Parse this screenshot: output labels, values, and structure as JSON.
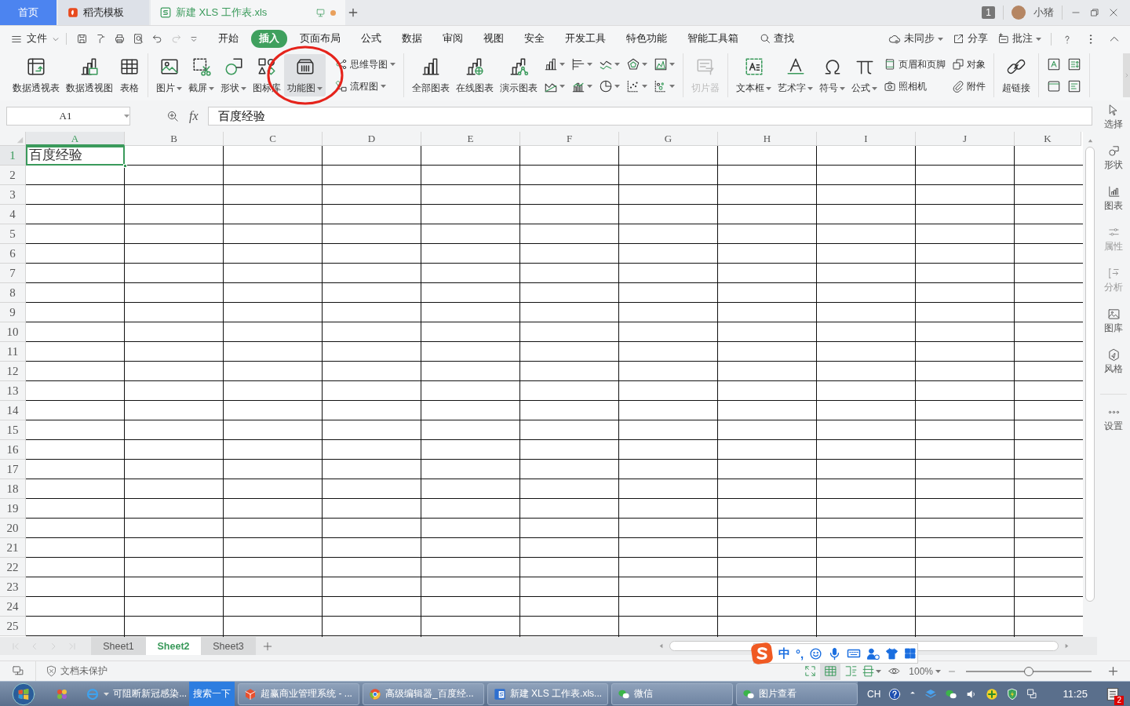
{
  "title_bar": {
    "tabs": [
      {
        "label": "首页",
        "kind": "home",
        "selected": false,
        "modified": false
      },
      {
        "label": "稻壳模板",
        "kind": "docer",
        "selected": false,
        "modified": false
      },
      {
        "label": "新建 XLS 工作表.xls",
        "kind": "sheet",
        "selected": true,
        "modified": true
      }
    ],
    "window_count": "1",
    "user": "小猪"
  },
  "menu_bar": {
    "file": "文件",
    "tabs": [
      {
        "label": "开始",
        "selected": false
      },
      {
        "label": "插入",
        "selected": true
      },
      {
        "label": "页面布局",
        "selected": false
      },
      {
        "label": "公式",
        "selected": false
      },
      {
        "label": "数据",
        "selected": false
      },
      {
        "label": "审阅",
        "selected": false
      },
      {
        "label": "视图",
        "selected": false
      },
      {
        "label": "安全",
        "selected": false
      },
      {
        "label": "开发工具",
        "selected": false
      },
      {
        "label": "特色功能",
        "selected": false
      },
      {
        "label": "智能工具箱",
        "selected": false
      }
    ],
    "search": "查找",
    "sync": "未同步",
    "share": "分享",
    "comment": "批注"
  },
  "ribbon": {
    "groups": [
      {
        "columns": [
          {
            "items": [
              {
                "label": "数据透视表",
                "kind": "large",
                "dropdown": false,
                "highlighted": false,
                "disabled": false
              }
            ]
          },
          {
            "items": [
              {
                "label": "数据透视图",
                "kind": "large",
                "dropdown": false,
                "highlighted": false,
                "disabled": false
              }
            ]
          },
          {
            "items": [
              {
                "label": "表格",
                "kind": "large",
                "dropdown": false,
                "highlighted": false,
                "disabled": false
              }
            ]
          }
        ]
      },
      {
        "columns": [
          {
            "items": [
              {
                "label": "图片",
                "kind": "large",
                "dropdown": true,
                "highlighted": false,
                "disabled": false
              }
            ]
          },
          {
            "items": [
              {
                "label": "截屏",
                "kind": "large",
                "dropdown": true,
                "highlighted": false,
                "disabled": false
              }
            ]
          },
          {
            "items": [
              {
                "label": "形状",
                "kind": "large",
                "dropdown": true,
                "highlighted": false,
                "disabled": false
              }
            ]
          },
          {
            "items": [
              {
                "label": "图标库",
                "kind": "large",
                "dropdown": false,
                "highlighted": false,
                "disabled": false
              }
            ]
          },
          {
            "items": [
              {
                "label": "功能图",
                "kind": "large",
                "dropdown": true,
                "highlighted": true,
                "disabled": false
              }
            ]
          },
          {
            "items": [
              {
                "label": "思维导图",
                "kind": "small",
                "dropdown": true,
                "highlighted": false,
                "disabled": false
              },
              {
                "label": "流程图",
                "kind": "small",
                "dropdown": true,
                "highlighted": false,
                "disabled": false
              }
            ]
          }
        ]
      },
      {
        "columns": [
          {
            "items": [
              {
                "label": "全部图表",
                "kind": "large",
                "dropdown": false,
                "highlighted": false,
                "disabled": false
              }
            ]
          },
          {
            "items": [
              {
                "label": "在线图表",
                "kind": "large",
                "dropdown": false,
                "highlighted": false,
                "disabled": false
              }
            ]
          },
          {
            "items": [
              {
                "label": "演示图表",
                "kind": "large",
                "dropdown": false,
                "highlighted": false,
                "disabled": false
              }
            ]
          },
          {
            "items": [
              {
                "kind": "icon",
                "dropdown": true,
                "highlighted": false,
                "disabled": false
              },
              {
                "kind": "icon",
                "dropdown": true,
                "highlighted": false,
                "disabled": false
              }
            ]
          },
          {
            "items": [
              {
                "kind": "icon",
                "dropdown": true,
                "highlighted": false,
                "disabled": false
              },
              {
                "kind": "icon",
                "dropdown": true,
                "highlighted": false,
                "disabled": false
              }
            ]
          },
          {
            "items": [
              {
                "kind": "icon",
                "dropdown": true,
                "highlighted": false,
                "disabled": false
              },
              {
                "kind": "icon",
                "dropdown": true,
                "highlighted": false,
                "disabled": false
              }
            ]
          },
          {
            "items": [
              {
                "kind": "icon",
                "dropdown": true,
                "highlighted": false,
                "disabled": false
              },
              {
                "kind": "icon",
                "dropdown": true,
                "highlighted": false,
                "disabled": false
              }
            ]
          },
          {
            "items": [
              {
                "kind": "icon",
                "dropdown": true,
                "highlighted": false,
                "disabled": false
              },
              {
                "kind": "icon",
                "dropdown": true,
                "highlighted": false,
                "disabled": false
              }
            ]
          }
        ]
      },
      {
        "columns": [
          {
            "items": [
              {
                "label": "切片器",
                "kind": "large",
                "dropdown": false,
                "highlighted": false,
                "disabled": true
              }
            ]
          }
        ]
      },
      {
        "columns": [
          {
            "items": [
              {
                "label": "文本框",
                "kind": "large",
                "dropdown": true,
                "highlighted": false,
                "disabled": false
              }
            ]
          },
          {
            "items": [
              {
                "label": "艺术字",
                "kind": "large",
                "dropdown": true,
                "highlighted": false,
                "disabled": false
              }
            ]
          },
          {
            "items": [
              {
                "label": "符号",
                "kind": "large",
                "dropdown": true,
                "highlighted": false,
                "disabled": false
              }
            ]
          },
          {
            "items": [
              {
                "label": "公式",
                "kind": "large",
                "dropdown": true,
                "highlighted": false,
                "disabled": false
              }
            ]
          },
          {
            "items": [
              {
                "label": "页眉和页脚",
                "kind": "small",
                "dropdown": false,
                "highlighted": false,
                "disabled": false
              },
              {
                "label": "照相机",
                "kind": "small",
                "dropdown": false,
                "highlighted": false,
                "disabled": false
              }
            ]
          },
          {
            "items": [
              {
                "label": "对象",
                "kind": "small",
                "dropdown": false,
                "highlighted": false,
                "disabled": false
              },
              {
                "label": "附件",
                "kind": "small",
                "dropdown": false,
                "highlighted": false,
                "disabled": false
              }
            ]
          }
        ]
      },
      {
        "columns": [
          {
            "items": [
              {
                "label": "超链接",
                "kind": "large",
                "dropdown": false,
                "highlighted": false,
                "disabled": false
              }
            ]
          }
        ]
      },
      {
        "columns": [
          {
            "items": [
              {
                "kind": "icon",
                "dropdown": false,
                "highlighted": false,
                "disabled": false
              },
              {
                "kind": "icon",
                "dropdown": false,
                "highlighted": false,
                "disabled": false
              }
            ]
          },
          {
            "items": [
              {
                "kind": "icon",
                "dropdown": false,
                "highlighted": false,
                "disabled": false
              },
              {
                "kind": "icon",
                "dropdown": false,
                "highlighted": false,
                "disabled": false
              }
            ]
          }
        ]
      }
    ]
  },
  "annotation": {
    "kind": "ellipse"
  },
  "formula_bar": {
    "name_box": "A1",
    "fx": "fx",
    "formula": "百度经验"
  },
  "sheet": {
    "columns": [
      {
        "label": "A",
        "selected": true
      },
      {
        "label": "B",
        "selected": false
      },
      {
        "label": "C",
        "selected": false
      },
      {
        "label": "D",
        "selected": false
      },
      {
        "label": "E",
        "selected": false
      },
      {
        "label": "F",
        "selected": false
      },
      {
        "label": "G",
        "selected": false
      },
      {
        "label": "H",
        "selected": false
      },
      {
        "label": "I",
        "selected": false
      },
      {
        "label": "J",
        "selected": false
      },
      {
        "label": "K",
        "selected": false
      }
    ],
    "rows": [
      {
        "number": "1",
        "selected": true,
        "values": [
          {
            "text": "百度经验",
            "selected": true
          }
        ]
      },
      {
        "number": "2",
        "selected": false
      },
      {
        "number": "3",
        "selected": false
      },
      {
        "number": "4",
        "selected": false
      },
      {
        "number": "5",
        "selected": false
      },
      {
        "number": "6",
        "selected": false
      },
      {
        "number": "7",
        "selected": false
      },
      {
        "number": "8",
        "selected": false
      },
      {
        "number": "9",
        "selected": false
      },
      {
        "number": "10",
        "selected": false
      },
      {
        "number": "11",
        "selected": false
      },
      {
        "number": "12",
        "selected": false
      },
      {
        "number": "13",
        "selected": false
      },
      {
        "number": "14",
        "selected": false
      },
      {
        "number": "15",
        "selected": false
      },
      {
        "number": "16",
        "selected": false
      },
      {
        "number": "17",
        "selected": false
      },
      {
        "number": "18",
        "selected": false
      },
      {
        "number": "19",
        "selected": false
      },
      {
        "number": "20",
        "selected": false
      },
      {
        "number": "21",
        "selected": false
      },
      {
        "number": "22",
        "selected": false
      },
      {
        "number": "23",
        "selected": false
      },
      {
        "number": "24",
        "selected": false
      },
      {
        "number": "25",
        "selected": false
      }
    ]
  },
  "side_panel": {
    "items": [
      {
        "label": "选择",
        "disabled": false
      },
      {
        "label": "形状",
        "disabled": false
      },
      {
        "label": "图表",
        "disabled": false
      },
      {
        "label": "属性",
        "disabled": true
      },
      {
        "label": "分析",
        "disabled": true
      },
      {
        "label": "图库",
        "disabled": false
      },
      {
        "label": "风格",
        "disabled": false
      },
      {
        "label": "设置",
        "disabled": false
      }
    ]
  },
  "sheet_tabs": [
    {
      "label": "Sheet1",
      "selected": false
    },
    {
      "label": "Sheet2",
      "selected": true
    },
    {
      "label": "Sheet3",
      "selected": false
    }
  ],
  "status_bar": {
    "protection": "文档未保护",
    "views": [
      {
        "selected": false
      },
      {
        "selected": true
      },
      {
        "selected": false
      },
      {
        "selected": false
      }
    ],
    "zoom": "100%",
    "zoom_slider": {
      "level": 0.5
    }
  },
  "ime_toolbar": {
    "mode": "中",
    "punctuation": "°,"
  },
  "taskbar": {
    "browser_tab": "可阻断新冠感染...",
    "search_button": "搜索一下",
    "windows": [
      {
        "label": "超赢商业管理系统 - ...",
        "kind": "cube"
      },
      {
        "label": "高级编辑器_百度经...",
        "kind": "chrome"
      },
      {
        "label": "新建 XLS 工作表.xls...",
        "kind": "sheet"
      },
      {
        "label": "微信",
        "kind": "chat"
      },
      {
        "label": "图片查看",
        "kind": "chat"
      }
    ],
    "language": "CH",
    "time": "11:25",
    "notifications": "2"
  }
}
